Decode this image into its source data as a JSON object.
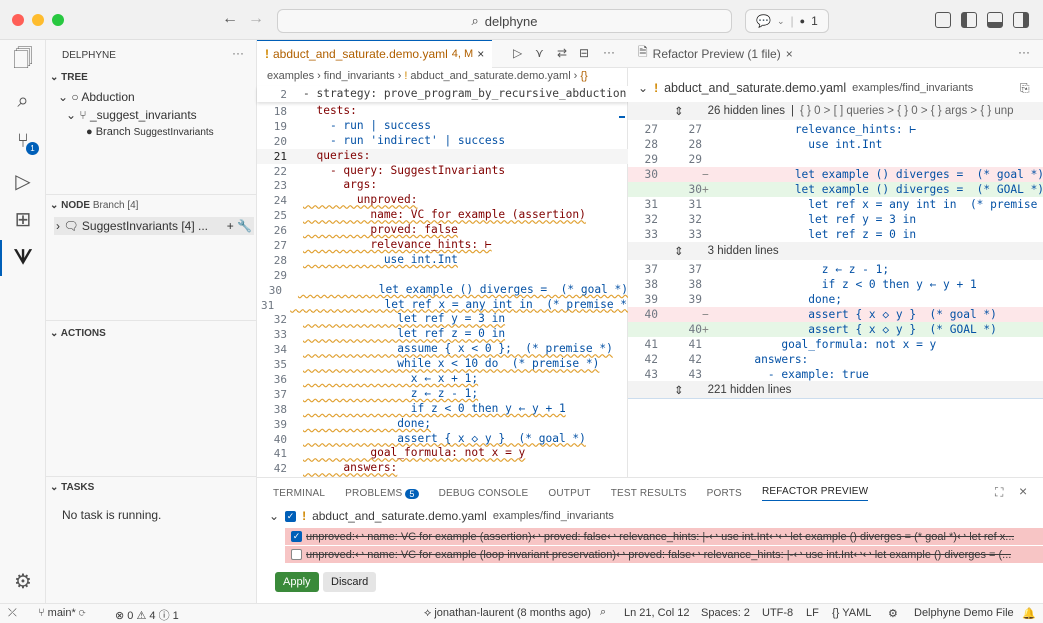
{
  "title_bar": {
    "search": "delphyne",
    "copilot_badge": "1"
  },
  "sidebar": {
    "title": "DELPHYNE",
    "tree_header": "TREE",
    "tree_root": "Abduction",
    "tree_child": "_suggest_invariants",
    "tree_leaf": "Branch",
    "tree_leaf_detail": "SuggestInvariants",
    "node_header": "NODE",
    "node_detail": "Branch [4]",
    "node_item": "SuggestInvariants",
    "node_item_detail": "[4] ...",
    "actions_header": "ACTIONS",
    "tasks_header": "TASKS",
    "tasks_empty": "No task is running."
  },
  "editor": {
    "tab_bang": "!",
    "tab_name": "abduct_and_saturate.demo.yaml",
    "tab_status": "4, M",
    "breadcrumb": [
      "examples",
      "find_invariants",
      "abduct_and_saturate.demo.yaml",
      "{}"
    ],
    "sticky_num": "2",
    "sticky_line": "- strategy: prove_program_by_recursive_abduction",
    "lines": [
      {
        "n": "18",
        "t": "  tests:"
      },
      {
        "n": "19",
        "t": "    - run | success"
      },
      {
        "n": "20",
        "t": "    - run 'indirect' | success"
      },
      {
        "n": "21",
        "t": "  queries:"
      },
      {
        "n": "22",
        "t": "    - query: SuggestInvariants"
      },
      {
        "n": "23",
        "t": "      args:"
      },
      {
        "n": "24",
        "t": "        unproved:"
      },
      {
        "n": "25",
        "t": "          name: VC for example (assertion)"
      },
      {
        "n": "26",
        "t": "          proved: false"
      },
      {
        "n": "27",
        "t": "          relevance_hints: ⊢"
      },
      {
        "n": "28",
        "t": "            use int.Int"
      },
      {
        "n": "29",
        "t": ""
      },
      {
        "n": "30",
        "t": "            let example () diverges =  (* goal *)"
      },
      {
        "n": "31",
        "t": "              let ref x = any int in  (* premise *)"
      },
      {
        "n": "32",
        "t": "              let ref y = 3 in"
      },
      {
        "n": "33",
        "t": "              let ref z = 0 in"
      },
      {
        "n": "34",
        "t": "              assume { x < 0 };  (* premise *)"
      },
      {
        "n": "35",
        "t": "              while x < 10 do  (* premise *)"
      },
      {
        "n": "36",
        "t": "                x ← x + 1;"
      },
      {
        "n": "37",
        "t": "                z ← z - 1;"
      },
      {
        "n": "38",
        "t": "                if z < 0 then y ← y + 1"
      },
      {
        "n": "39",
        "t": "              done;"
      },
      {
        "n": "40",
        "t": "              assert { x ◇ y }  (* goal *)"
      },
      {
        "n": "41",
        "t": "          goal_formula: not x = y"
      },
      {
        "n": "42",
        "t": "      answers:"
      }
    ]
  },
  "preview": {
    "tab": "Refactor Preview (1 file)",
    "file": "abduct_and_saturate.demo.yaml",
    "path": "examples/find_invariants",
    "hidden1": "26 hidden lines",
    "hidden1_crumbs": "{ } 0 > [ ] queries > { } 0 > { } args > { } unp",
    "hidden2": "3 hidden lines",
    "hidden3": "221 hidden lines",
    "block1": [
      {
        "a": "27",
        "b": "27",
        "m": "",
        "t": "            relevance_hints: ⊢",
        "k": ""
      },
      {
        "a": "28",
        "b": "28",
        "m": "",
        "t": "              use int.Int",
        "k": ""
      },
      {
        "a": "29",
        "b": "29",
        "m": "",
        "t": "",
        "k": ""
      },
      {
        "a": "30",
        "b": "",
        "m": "−",
        "t": "            let example () diverges =  (* goal *)",
        "k": "del"
      },
      {
        "a": "",
        "b": "30",
        "m": "+",
        "t": "            let example () diverges =  (* GOAL *)",
        "k": "ins"
      },
      {
        "a": "31",
        "b": "31",
        "m": "",
        "t": "              let ref x = any int in  (* premise *)",
        "k": ""
      },
      {
        "a": "32",
        "b": "32",
        "m": "",
        "t": "              let ref y = 3 in",
        "k": ""
      },
      {
        "a": "33",
        "b": "33",
        "m": "",
        "t": "              let ref z = 0 in",
        "k": ""
      }
    ],
    "block2": [
      {
        "a": "37",
        "b": "37",
        "m": "",
        "t": "                z ← z - 1;",
        "k": ""
      },
      {
        "a": "38",
        "b": "38",
        "m": "",
        "t": "                if z < 0 then y ← y + 1",
        "k": ""
      },
      {
        "a": "39",
        "b": "39",
        "m": "",
        "t": "              done;",
        "k": ""
      },
      {
        "a": "40",
        "b": "",
        "m": "−",
        "t": "              assert { x ◇ y }  (* goal *)",
        "k": "del"
      },
      {
        "a": "",
        "b": "40",
        "m": "+",
        "t": "              assert { x ◇ y }  (* GOAL *)",
        "k": "ins"
      },
      {
        "a": "41",
        "b": "41",
        "m": "",
        "t": "          goal_formula: not x = y",
        "k": ""
      },
      {
        "a": "42",
        "b": "42",
        "m": "",
        "t": "      answers:",
        "k": ""
      },
      {
        "a": "43",
        "b": "43",
        "m": "",
        "t": "        - example: true",
        "k": ""
      }
    ]
  },
  "panel": {
    "tabs": [
      "TERMINAL",
      "PROBLEMS",
      "DEBUG CONSOLE",
      "OUTPUT",
      "TEST RESULTS",
      "PORTS",
      "REFACTOR PREVIEW"
    ],
    "problems_count": "5",
    "file_bang": "!",
    "file": "abduct_and_saturate.demo.yaml",
    "path": "examples/find_invariants",
    "change1": "unproved:↩ name: VC for example (assertion)↩ proved: false↩ relevance_hints: |-↩ use int.Int↩↩ let example () diverges = (* goal *)↩ let ref x...",
    "change2": "unproved:↩ name: VC for example (loop invariant preservation)↩ proved: false↩ relevance_hints: |-↩ use int.Int↩↩ let example () diverges = (...",
    "apply": "Apply",
    "discard": "Discard"
  },
  "status": {
    "branch": "main*",
    "errors": "0",
    "warnings": "4",
    "infos": "1",
    "blame": "jonathan-laurent (8 months ago)",
    "position": "Ln 21, Col 12",
    "spaces": "Spaces: 2",
    "encoding": "UTF-8",
    "eol": "LF",
    "language": "YAML",
    "extension": "Delphyne Demo File"
  }
}
